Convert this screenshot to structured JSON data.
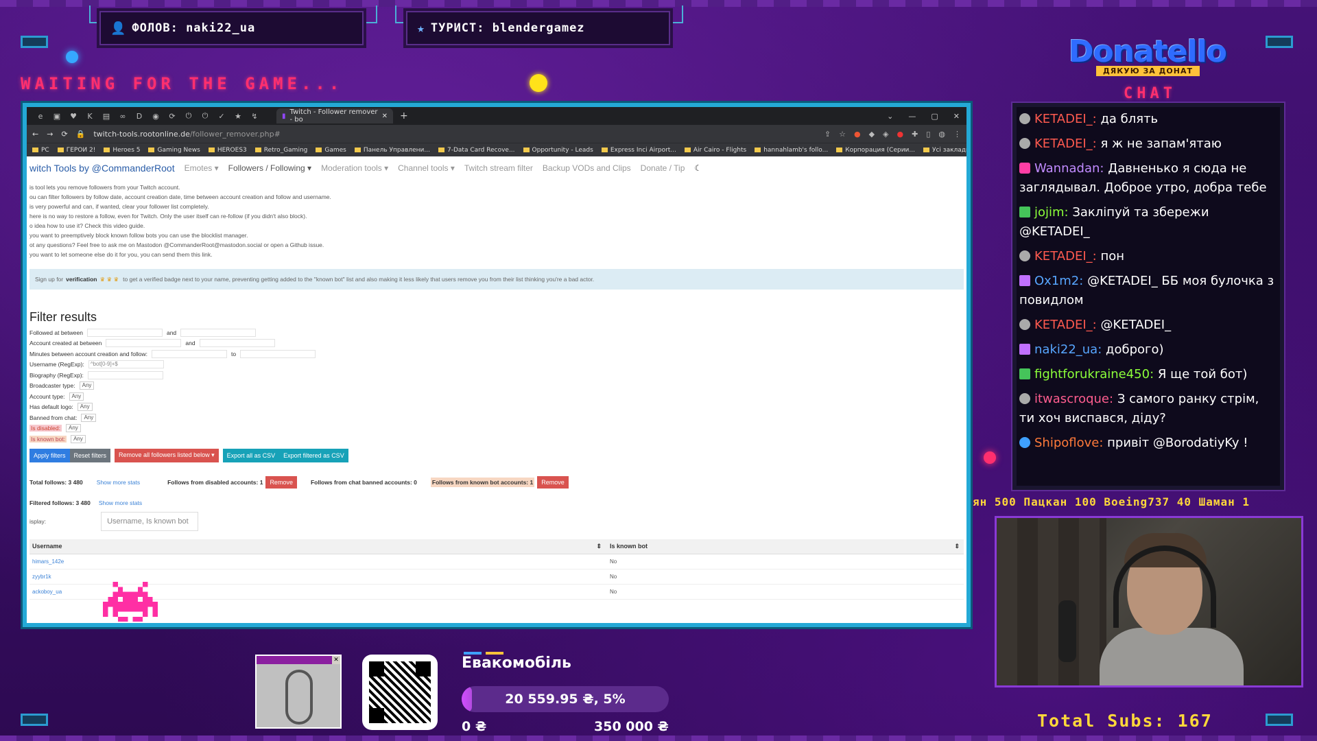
{
  "overlay": {
    "follow_label": "ФОЛОВ: naki22_ua",
    "tourist_label": "ТУРИСТ: blendergamez",
    "waiting_text": "WAITING FOR THE GAME...",
    "chat_label": "CHAT",
    "logo_word": "Donatello",
    "logo_tagline": "ДЯКУЮ ЗА ДОНАТ",
    "ticker": "ян 500  Пацкан 100  Boeing737 40  Шаман 1",
    "total_subs": "Total Subs: 167"
  },
  "browser": {
    "tab_title": "Twitch - Follower remover - bo",
    "url_host": "twitch-tools.rootonline.de",
    "url_path": "/follower_remover.php#",
    "bookmarks": [
      "PC",
      "ГЕРОИ 2!",
      "Heroes 5",
      "Gaming News",
      "HEROES3",
      "Retro_Gaming",
      "Games",
      "Панель Управлени...",
      "7-Data Card Recove...",
      "Opportunity - Leads",
      "Express Inci Airport...",
      "Air Cairo - Flights",
      "hannahlamb's follo...",
      "Корпорация (Серии...",
      "Усі закладки"
    ]
  },
  "page": {
    "brand": "witch Tools",
    "brand_by": "by @CommanderRoot",
    "nav": [
      "Emotes ▾",
      "Followers / Following ▾",
      "Moderation tools ▾",
      "Channel tools ▾",
      "Twitch stream filter",
      "Backup VODs and Clips",
      "Donate / Tip"
    ],
    "intro_lines": [
      "is tool lets you remove followers from your Twitch account.",
      "ou can filter followers by follow date, account creation date, time between account creation and follow and username.",
      "is very powerful and can, if wanted, clear your follower list completely.",
      "here is no way to restore a follow, even for Twitch. Only the user itself can re-follow (if you didn't also block).",
      "o idea how to use it? Check this video guide.",
      "you want to preemptively block known follow bots you can use the blocklist manager.",
      "ot any questions? Feel free to ask me on Mastodon @CommanderRoot@mastodon.social or open a Github issue.",
      "you want to let someone else do it for you, you can send them this link."
    ],
    "verify_prefix": "Sign up for",
    "verify_bold": "verification",
    "verify_text": "to get a verified badge next to your name, preventing getting added to the \"known bot\" list and also making it less likely that users remove you from their list thinking you're a bad actor.",
    "filter_title": "Filter results",
    "filters": {
      "followed_at": "Followed at between",
      "and": "and",
      "account_created": "Account created at between",
      "minutes_between": "Minutes between account creation and follow:",
      "to": "to",
      "username": "Username (RegExp):",
      "username_value": "^bot[0-9]+$",
      "biography": "Biography (RegExp):",
      "broadcaster_type": "Broadcaster type:",
      "account_type": "Account type:",
      "default_logo": "Has default logo:",
      "banned_chat": "Banned from chat:",
      "disabled": "Is disabled:",
      "known_bot": "Is known bot:",
      "any": "Any"
    },
    "buttons": {
      "apply": "Apply filters",
      "reset": "Reset filters",
      "remove_all": "Remove all followers listed below ▾",
      "export_all": "Export all as CSV",
      "export_filtered": "Export filtered as CSV"
    },
    "stats": {
      "total_follows": "Total follows: 3 480",
      "show_more": "Show more stats",
      "from_disabled": "Follows from disabled accounts: 1",
      "remove": "Remove",
      "from_banned": "Follows from chat banned accounts: 0",
      "from_known_bot": "Follows from known bot accounts: 1",
      "filtered_follows": "Filtered follows: 3 480"
    },
    "display_label": "isplay:",
    "display_placeholder": "Username, Is known bot",
    "table": {
      "col_username": "Username",
      "col_known_bot": "Is known bot",
      "rows": [
        {
          "username": "himars_142e",
          "known": "No"
        },
        {
          "username": "zyybr1k",
          "known": "No"
        },
        {
          "username": "ackoboy_ua",
          "known": "No"
        }
      ]
    }
  },
  "chat": [
    {
      "user": "KETADEI_:",
      "text": "да блять",
      "color": "red"
    },
    {
      "user": "KETADEI_:",
      "text": "я ж не запам'ятаю",
      "color": "red"
    },
    {
      "user": "Wannadan:",
      "text": "Давненько я сюда не заглядывал. Доброе утро, добра тебе",
      "color": "purple"
    },
    {
      "user": "jojim:",
      "text": "Закліпуй та збережи @KETADEI_",
      "color": "green"
    },
    {
      "user": "KETADEI_:",
      "text": "пон",
      "color": "red"
    },
    {
      "user": "Ox1m2:",
      "text": "@KETADEI_ ББ моя булочка з повидлом",
      "color": "blue"
    },
    {
      "user": "KETADEI_:",
      "text": "@KETADEI_",
      "color": "red"
    },
    {
      "user": "naki22_ua:",
      "text": "доброго)",
      "color": "blue"
    },
    {
      "user": "fightforukraine450:",
      "text": "Я ще той бот)",
      "color": "green"
    },
    {
      "user": "itwascroque:",
      "text": "З самого ранку стрім, ти хоч виспався, діду?",
      "color": "pink"
    },
    {
      "user": "Shipoflove:",
      "text": "привіт @BorodatiyKy !",
      "color": "orange"
    }
  ],
  "goal": {
    "title": "Евакомобіль",
    "progress_text": "20 559.95 ₴, 5%",
    "progress_fraction": 0.05,
    "min": "0 ₴",
    "max": "350 000 ₴"
  },
  "colors": {
    "background": "#3a0d63",
    "accent_blue": "#24a9d6",
    "accent_pink": "#ff2f6e",
    "accent_yellow": "#ffd83a"
  }
}
